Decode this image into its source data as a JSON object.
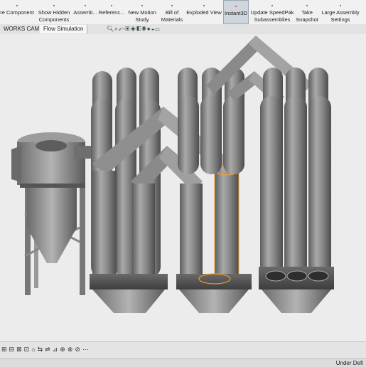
{
  "ribbon": {
    "buttons": [
      {
        "label": "re Component"
      },
      {
        "label": "Show Hidden Components"
      },
      {
        "label": "Assemb..."
      },
      {
        "label": "Referenc..."
      },
      {
        "label": "New Motion Study"
      },
      {
        "label": "Bill of Materials"
      },
      {
        "label": "Exploded View"
      },
      {
        "label": "Instant3D"
      },
      {
        "label": "Update SpeedPak Subassemblies"
      },
      {
        "label": "Take Snapshot"
      },
      {
        "label": "Large Assembly Settings"
      }
    ]
  },
  "tabs": [
    {
      "label": "WORKS CAM"
    },
    {
      "label": "Flow Simulation"
    }
  ],
  "view_toolbar_icons": [
    "zoom-icon",
    "zoom-area-icon",
    "previous-view-icon",
    "section-view-icon",
    "view-orientation-icon",
    "display-style-icon",
    "hide-show-icon",
    "appearance-icon",
    "scene-icon",
    "display-settings-icon"
  ],
  "bottom_toolbar_icons": [
    "icon-1",
    "icon-2",
    "icon-3",
    "icon-4",
    "icon-5",
    "icon-6",
    "icon-7",
    "icon-8",
    "icon-9",
    "icon-10",
    "icon-11",
    "icon-12"
  ],
  "status": {
    "text": "Under Defi"
  },
  "colors": {
    "ribbon_bg": "#f1f1f1",
    "active_bg": "#cfd6de",
    "selection": "#f39a2b"
  }
}
